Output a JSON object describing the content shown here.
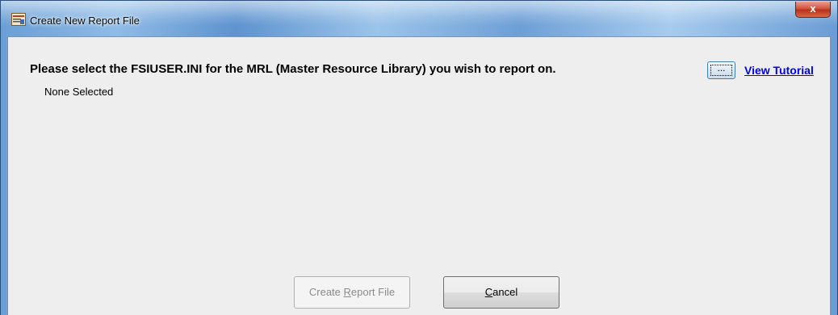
{
  "window": {
    "title": "Create New Report File",
    "close_label": "x"
  },
  "content": {
    "prompt": "Please select the FSIUSER.INI for the MRL (Master Resource Library) you wish to report on.",
    "browse_label": "...",
    "tutorial_link": "View Tutorial",
    "selection_status": "None Selected"
  },
  "buttons": {
    "create": {
      "pre": "Create ",
      "mnemonic": "R",
      "post": "eport File",
      "enabled": false
    },
    "cancel": {
      "pre": "",
      "mnemonic": "C",
      "post": "ancel",
      "enabled": true
    }
  }
}
